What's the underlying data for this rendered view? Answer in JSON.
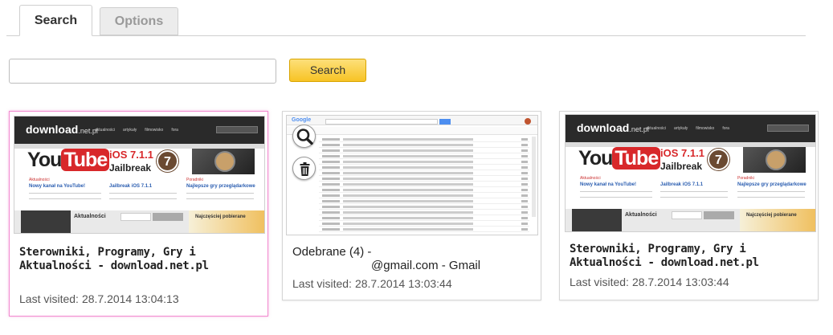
{
  "tabs": [
    {
      "label": "Search",
      "active": true
    },
    {
      "label": "Options",
      "active": false
    }
  ],
  "search": {
    "input_value": "",
    "placeholder": "",
    "button_label": "Search"
  },
  "cards": [
    {
      "title_line1": "Sterowniki, Programy, Gry i",
      "title_line2": "Aktualności - download.net.pl",
      "visited_label": "Last visited:",
      "visited_time": "28.7.2014 13:04:13",
      "selected": true
    },
    {
      "title_line1": "Odebrane (4) -",
      "title_line2": "@gmail.com - Gmail",
      "visited_label": "Last visited:",
      "visited_time": "28.7.2014 13:03:44",
      "selected": false
    },
    {
      "title_line1": "Sterowniki, Programy, Gry i",
      "title_line2": "Aktualności - download.net.pl",
      "visited_label": "Last visited:",
      "visited_time": "28.7.2014 13:03:44",
      "selected": false
    }
  ],
  "thumb_dn": {
    "logo": "download",
    "logo_suffix": ".net.pl",
    "nav": [
      "aktualności",
      "artykuły",
      "filmowisko",
      "fora"
    ],
    "yt_you": "You",
    "yt_tube": "Tube",
    "ios_line1": "iOS 7.1.1",
    "ios_line2": "Jailbreak",
    "ios_badge": "7",
    "yt_caption": "Nowy kanał na YouTube!",
    "ios_caption": "Jailbreak iOS 7.1.1",
    "game_caption": "Najlepsze gry przeglądarkowe",
    "tag_left": "Aktualności",
    "tag_right": "Poradniki",
    "footer_tab": "Aktualności",
    "footer_ad": "Najczęściej pobierane"
  },
  "thumb_gm": {
    "logo": "Google"
  },
  "icons": {
    "magnifier": "search-icon",
    "trash": "trash-icon"
  }
}
